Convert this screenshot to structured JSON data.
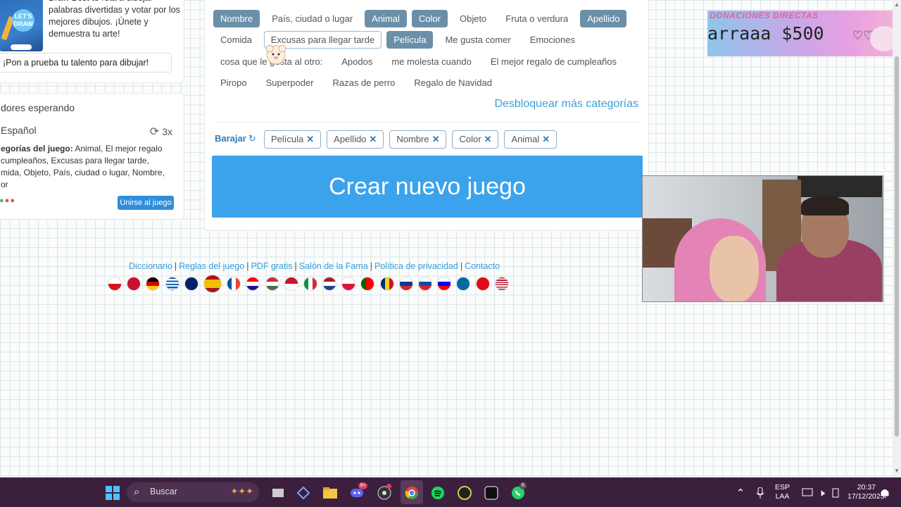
{
  "promo": {
    "text": "Draw Best te reta a dibujar palabras divertidas y votar por los mejores dibujos. ¡Únete y demuestra tu arte!",
    "badge": "LET'S DRAW",
    "button": "¡Pon a prueba tu talento para dibujar!"
  },
  "waiting": {
    "title": "dores esperando",
    "language": "Español",
    "count": "3x",
    "categories_label": "egorías del juego:",
    "categories_text": " Animal, El mejor regalo cumpleaños, Excusas para llegar tarde, mida, Objeto, País, ciudad o lugar, Nombre, or",
    "join_button": "Unirse al juego"
  },
  "categories": {
    "rows": [
      [
        {
          "label": "Nombre",
          "selected": true
        },
        {
          "label": "País, ciudad o lugar",
          "selected": false
        },
        {
          "label": "Animal",
          "selected": true
        },
        {
          "label": "Color",
          "selected": true
        },
        {
          "label": "Objeto",
          "selected": false
        },
        {
          "label": "Fruta o verdura",
          "selected": false
        },
        {
          "label": "Apellido",
          "selected": true
        }
      ],
      [
        {
          "label": "Comida",
          "selected": false
        },
        {
          "label": "Excusas para llegar tarde",
          "selected": false,
          "hover": true
        },
        {
          "label": "Película",
          "selected": true
        },
        {
          "label": "Me gusta comer",
          "selected": false
        },
        {
          "label": "Emociones",
          "selected": false
        }
      ],
      [
        {
          "label": "cosa que le gusta al otro:",
          "selected": false
        },
        {
          "label": "Apodos",
          "selected": false
        },
        {
          "label": "me molesta cuando",
          "selected": false
        },
        {
          "label": "El mejor regalo de cumpleaños",
          "selected": false
        }
      ],
      [
        {
          "label": "Piropo",
          "selected": false
        },
        {
          "label": "Superpoder",
          "selected": false
        },
        {
          "label": "Razas de perro",
          "selected": false
        },
        {
          "label": "Regalo de Navidad",
          "selected": false
        }
      ]
    ],
    "unlock_link": "Desbloquear más categorías"
  },
  "selection": {
    "shuffle_label": "Barajar",
    "chips": [
      "Película",
      "Apellido",
      "Nombre",
      "Color",
      "Animal"
    ],
    "remove_glyph": "✕"
  },
  "create_button": "Crear nuevo juego",
  "footer": {
    "links": [
      "Diccionario",
      "Reglas del juego",
      "PDF gratis",
      "Salón de la Fama",
      "Política de privacidad",
      "Contacto"
    ],
    "flags": [
      "cz",
      "dk",
      "de",
      "gr",
      "gb",
      "es",
      "fr",
      "hr",
      "hu",
      "id",
      "it",
      "nl",
      "pl",
      "pt",
      "ro",
      "ru",
      "sk",
      "si",
      "se",
      "tr",
      "us"
    ]
  },
  "donations": {
    "title": "DONACIONES DIRECTAS",
    "amount": "arraaa $500",
    "hearts": "♡♡"
  },
  "taskbar": {
    "search_placeholder": "Buscar",
    "language_top": "ESP",
    "language_bottom": "LAA",
    "time": "20:37",
    "date": "17/12/2025",
    "discord_badge": "9+",
    "whatsapp_badge": "6"
  },
  "colors": {
    "selected_category": "#6b8fa8",
    "primary_button": "#3ba3ec",
    "link": "#3aa0d8",
    "taskbar": "#3c1f3d"
  }
}
